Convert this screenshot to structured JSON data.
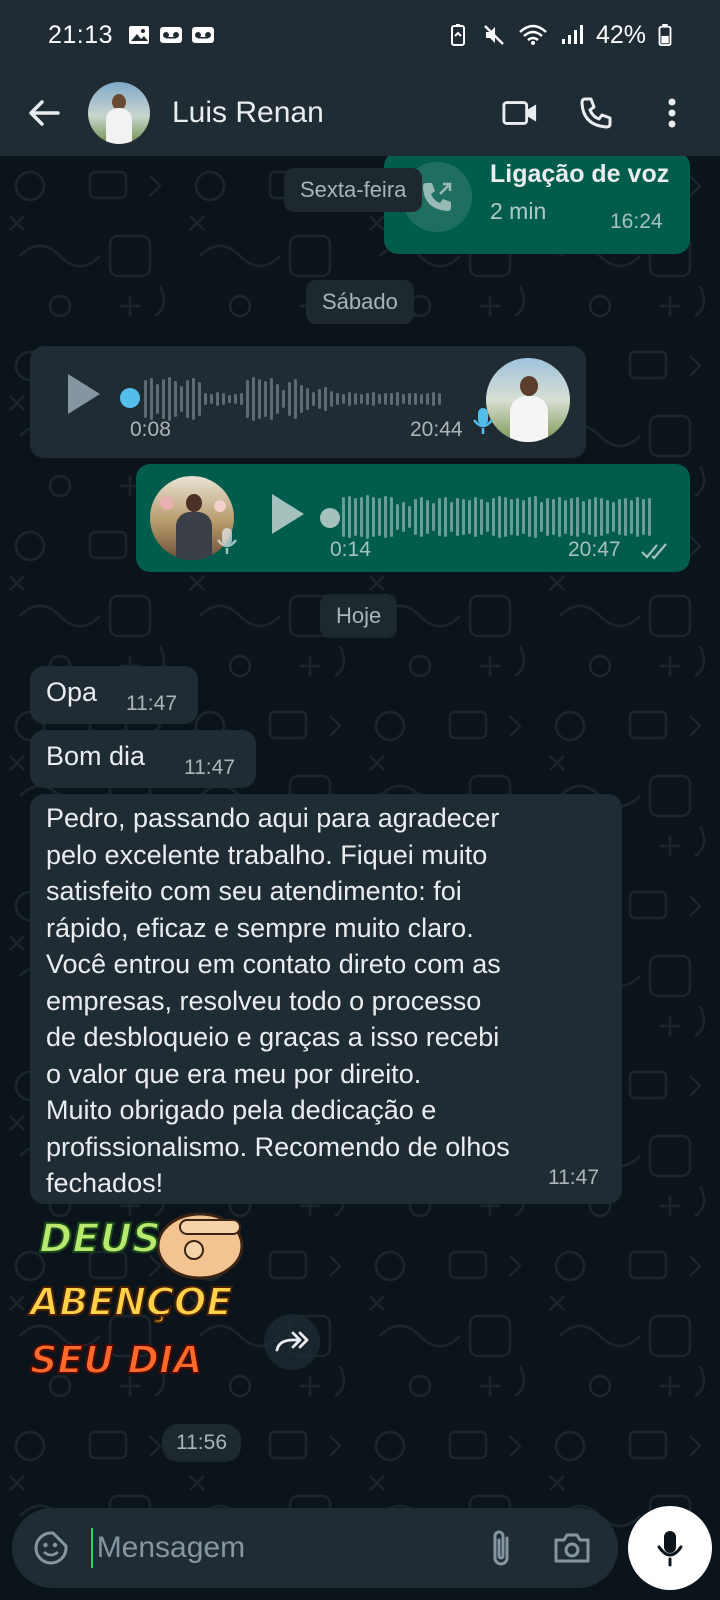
{
  "status_bar": {
    "time": "21:13",
    "battery": "42%"
  },
  "header": {
    "contact_name": "Luis Renan"
  },
  "chat": {
    "date_friday": "Sexta-feira",
    "voice_call": {
      "title": "Ligação de voz",
      "duration": "2 min",
      "time": "16:24"
    },
    "date_saturday": "Sábado",
    "audio_in": {
      "duration": "0:08",
      "time": "20:44"
    },
    "audio_out": {
      "duration": "0:14",
      "time": "20:47",
      "status": "read"
    },
    "date_today": "Hoje",
    "messages": [
      {
        "text": "Opa",
        "time": "11:47"
      },
      {
        "text": "Bom dia",
        "time": "11:47"
      },
      {
        "text": "Pedro, passando aqui para agradecer\npelo excelente trabalho. Fiquei muito\nsatisfeito com seu atendimento: foi\nrápido, eficaz e sempre muito claro.\nVocê entrou em contato direto com as\nempresas, resolveu todo o processo\nde desbloqueio e graças a isso recebi\no valor que era meu por direito.\nMuito obrigado pela dedicação e\nprofissionalismo. Recomendo de olhos\nfechados!",
        "time": "11:47"
      }
    ],
    "sticker": {
      "line1": "DEUS",
      "line2": "ABENÇOE",
      "line3": "SEU DIA",
      "time": "11:56"
    }
  },
  "input": {
    "placeholder": "Mensagem"
  },
  "colors": {
    "outgoing_bubble": "#005c4b",
    "incoming_bubble": "#1f2c34",
    "background": "#0b141a",
    "accent": "#25d366"
  }
}
